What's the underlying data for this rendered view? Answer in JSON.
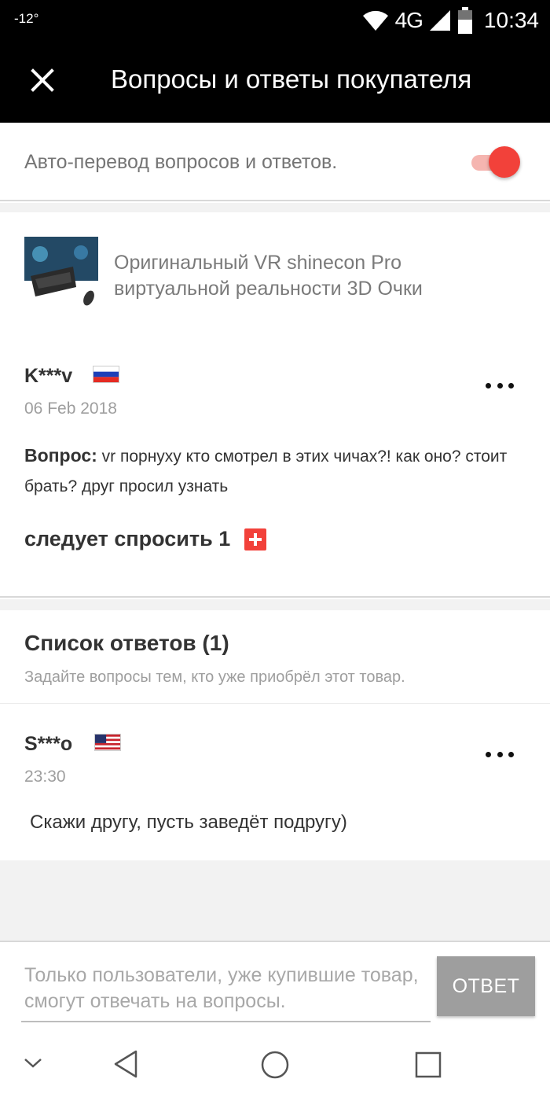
{
  "status_bar": {
    "temperature": "-12°",
    "network": "4G",
    "time": "10:34"
  },
  "app_bar": {
    "title": "Вопросы и ответы покупателя",
    "close_icon": "close-icon"
  },
  "auto_translate": {
    "label": "Авто-перевод вопросов и ответов.",
    "enabled": true,
    "accent_color": "#f2413a"
  },
  "product": {
    "name": "Оригинальный VR shinecon Pro виртуальной реальности 3D Очки",
    "thumbnail_icon": "vr-headset-image"
  },
  "question": {
    "user": "K***v",
    "flag": "russia-flag",
    "date": "06 Feb 2018",
    "prefix": "Вопрос:",
    "text": " vr порнуху кто смотрел в этих чичах?!  как оно? стоит брать?  друг  просил узнать",
    "ask_label": "следует спросить 1"
  },
  "answers": {
    "title": "Список ответов (1)",
    "hint": "Задайте вопросы тем, кто уже приобрёл этот товар.",
    "items": [
      {
        "user": "S***o",
        "flag": "usa-flag",
        "time": "23:30",
        "text": "Скажи другу, пусть заведёт подругу)"
      }
    ]
  },
  "reply": {
    "placeholder": "Только пользователи, уже купившие товар, смогут отвечать на вопросы.",
    "button_label": "ОТВЕТ"
  }
}
